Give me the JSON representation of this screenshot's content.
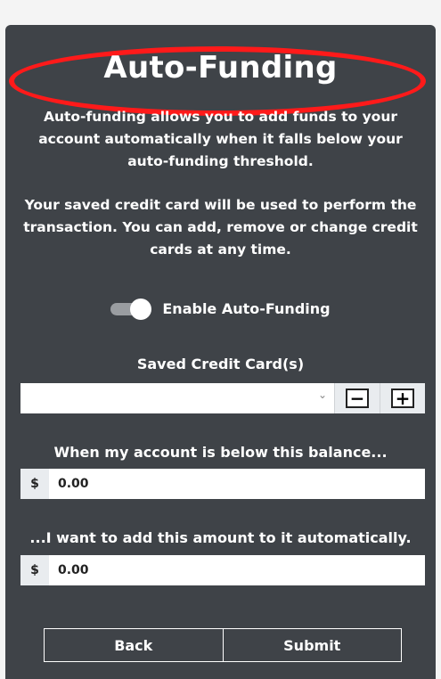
{
  "dialog": {
    "title": "Auto-Funding",
    "description_1": "Auto-funding allows you to add funds to your account automatically when it falls below your auto-funding threshold.",
    "description_2": "Your saved credit card will be used to perform the transaction. You can add, remove or change credit cards at any time."
  },
  "toggle": {
    "label": "Enable Auto-Funding",
    "state": "on"
  },
  "cards": {
    "label": "Saved Credit Card(s)",
    "selected": "",
    "remove_label": "−",
    "add_label": "+"
  },
  "threshold": {
    "label": "When my account is below this balance...",
    "currency": "$",
    "value": "0.00"
  },
  "topup": {
    "label": "...I want to add this amount to it automatically.",
    "currency": "$",
    "value": "0.00"
  },
  "buttons": {
    "back": "Back",
    "submit": "Submit"
  },
  "colors": {
    "panel_bg": "#3f4348",
    "highlight": "#ff1a1a"
  }
}
